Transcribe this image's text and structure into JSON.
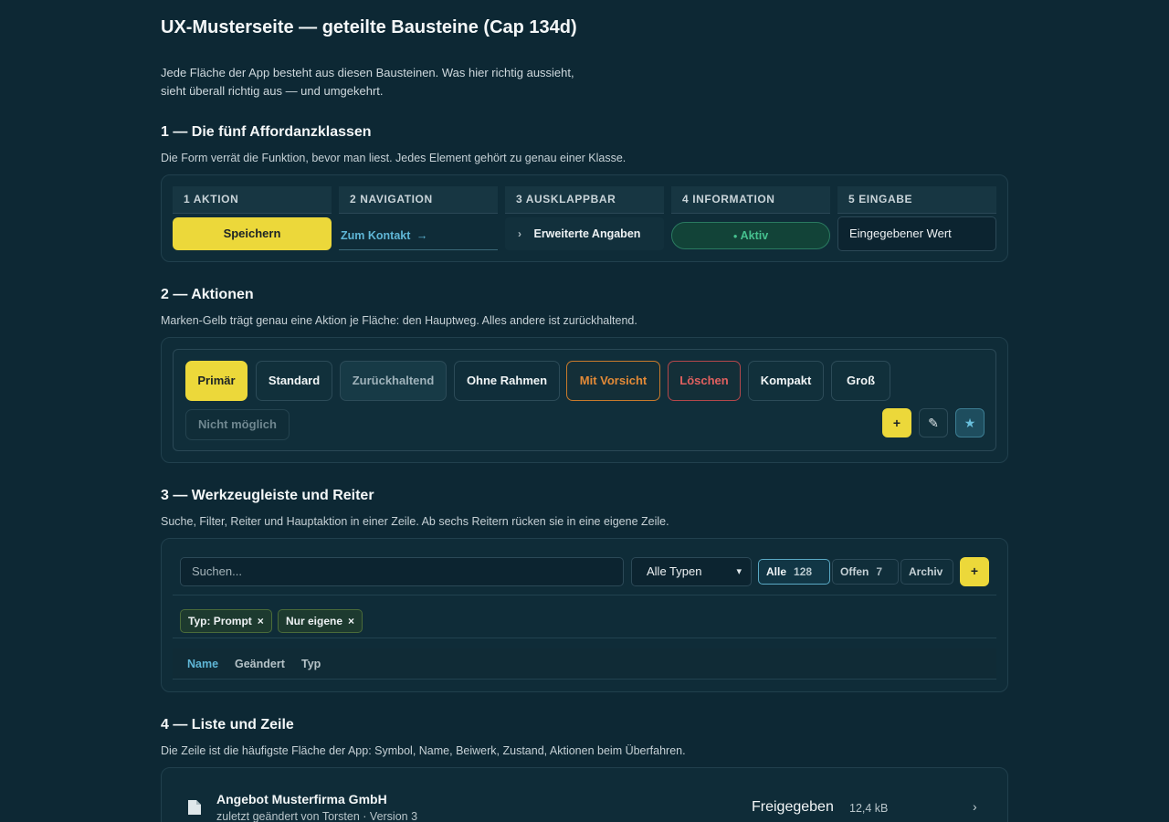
{
  "title": "UX-Musterseite — geteilte Bausteine (Cap 134d)",
  "intro": {
    "line1": "Jede Fläche der App besteht aus diesen Bausteinen. Was hier richtig aussieht,",
    "line2": "sieht überall richtig aus — und umgekehrt."
  },
  "s1": {
    "heading": "1 — Die fünf Affordanzklassen",
    "desc": "Die Form verrät die Funktion, bevor man liest. Jedes Element gehört zu genau einer Klasse.",
    "cols": [
      {
        "head": "1 AKTION",
        "sample": "Speichern"
      },
      {
        "head": "2 NAVIGATION",
        "sample": "Zum Kontakt",
        "arrow": "→"
      },
      {
        "head": "3 AUSKLAPPBAR",
        "sample": "Erweiterte Angaben",
        "chev": "›"
      },
      {
        "head": "4 INFORMATION",
        "sample": "Aktiv",
        "dot": "●"
      },
      {
        "head": "5 EINGABE",
        "sample": "Eingegebener Wert"
      }
    ]
  },
  "s2": {
    "heading": "2 — Aktionen",
    "desc": "Marken-Gelb trägt genau eine Aktion je Fläche: den Hauptweg. Alles andere ist zurückhaltend.",
    "buttons": {
      "primary": "Primär",
      "standard": "Standard",
      "subtle": "Zurückhaltend",
      "borderless": "Ohne Rahmen",
      "caution": "Mit Vorsicht",
      "delete": "Löschen",
      "compact": "Kompakt",
      "large": "Groß",
      "disabled": "Nicht möglich"
    },
    "icons": {
      "add": "+",
      "edit": "✎",
      "star": "★"
    }
  },
  "s3": {
    "heading": "3 — Werkzeugleiste und Reiter",
    "desc": "Suche, Filter, Reiter und Hauptaktion in einer Zeile. Ab sechs Reitern rücken sie in eine eigene Zeile.",
    "search_placeholder": "Suchen...",
    "type_select": "Alle Typen",
    "tabs": [
      {
        "label": "Alle",
        "count": "128"
      },
      {
        "label": "Offen",
        "count": "7"
      },
      {
        "label": "Archiv",
        "count": ""
      }
    ],
    "add": "+",
    "chips": [
      {
        "label": "Typ: Prompt",
        "x": "×"
      },
      {
        "label": "Nur eigene",
        "x": "×"
      }
    ],
    "columns": [
      "Name",
      "Geändert",
      "Typ"
    ]
  },
  "s4": {
    "heading": "4 — Liste und Zeile",
    "desc": "Die Zeile ist die häufigste Fläche der App: Symbol, Name, Beiwerk, Zustand, Aktionen beim Überfahren.",
    "row": {
      "title": "Angebot Musterfirma GmbH",
      "sub": "zuletzt geändert von Torsten · Version 3",
      "status": "Freigegeben",
      "size": "12,4 kB",
      "chev": "›"
    }
  },
  "colors": {
    "accent": "#ecd83a",
    "link": "#5fb6d6",
    "success": "#46c18f",
    "caution": "#e38a37",
    "danger": "#e0605f"
  }
}
